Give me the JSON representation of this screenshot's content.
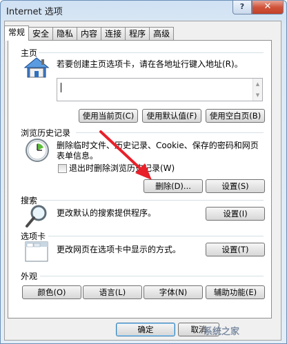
{
  "window": {
    "title": "Internet 选项",
    "help_glyph": "?",
    "close_glyph": "✕"
  },
  "tabs": [
    {
      "label": "常规",
      "active": true
    },
    {
      "label": "安全"
    },
    {
      "label": "隐私"
    },
    {
      "label": "内容"
    },
    {
      "label": "连接"
    },
    {
      "label": "程序"
    },
    {
      "label": "高级"
    }
  ],
  "home": {
    "section_label": "主页",
    "description": "若要创建主页选项卡，请在各地址行键入地址(R)。",
    "address_value": "",
    "buttons": {
      "use_current": "使用当前页(C)",
      "use_default": "使用默认值(F)",
      "use_blank": "使用空白页(B)"
    }
  },
  "history": {
    "section_label": "浏览历史记录",
    "description_line1": "删除临时文件、历史记录、Cookie、保存的密码和网页",
    "description_line2": "表单信息。",
    "checkbox_label": "退出时删除浏览历史记录(W)",
    "checkbox_checked": false,
    "buttons": {
      "delete": "删除(D)...",
      "settings": "设置(S)"
    }
  },
  "search": {
    "section_label": "搜索",
    "description": "更改默认的搜索提供程序。",
    "buttons": {
      "settings": "设置(I)"
    }
  },
  "tabs_section": {
    "section_label": "选项卡",
    "description": "更改网页在选项卡中显示的方式。",
    "buttons": {
      "settings": "设置(T)"
    }
  },
  "appearance": {
    "section_label": "外观",
    "buttons": {
      "colors": "颜色(O)",
      "languages": "语言(L)",
      "fonts": "字体(N)",
      "accessibility": "辅助功能(E)"
    }
  },
  "footer": {
    "ok": "确定",
    "cancel_partial": "取消"
  },
  "watermark": "系统之家"
}
